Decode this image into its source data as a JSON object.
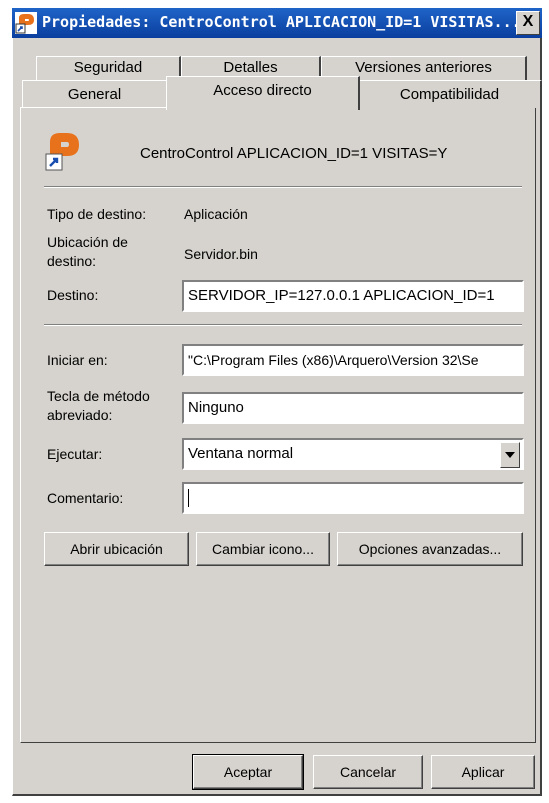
{
  "window": {
    "title": "Propiedades: CentroControl APLICACION_ID=1 VISITAS...",
    "close_label": "X"
  },
  "tabs": {
    "row1": [
      "Seguridad",
      "Detalles",
      "Versiones anteriores"
    ],
    "row2": [
      "General",
      "Acceso directo",
      "Compatibilidad"
    ],
    "active": "Acceso directo"
  },
  "shortcut": {
    "name": "CentroControl APLICACION_ID=1 VISITAS=Y",
    "icon": "shortcut-app-icon"
  },
  "fields": {
    "tipo_label": "Tipo de destino:",
    "tipo_value": "Aplicación",
    "ubicacion_label_1": "Ubicación de",
    "ubicacion_label_2": "destino:",
    "ubicacion_value": "Servidor.bin",
    "destino_label": "Destino:",
    "destino_value": "SERVIDOR_IP=127.0.0.1 APLICACION_ID=1",
    "iniciar_label": "Iniciar en:",
    "iniciar_value": "\"C:\\Program Files (x86)\\Arquero\\Version 32\\Se",
    "tecla_label_1": "Tecla de método",
    "tecla_label_2": "abreviado:",
    "tecla_value": "Ninguno",
    "ejecutar_label": "Ejecutar:",
    "ejecutar_value": "Ventana normal",
    "comentario_label": "Comentario:",
    "comentario_value": ""
  },
  "buttons": {
    "abrir": "Abrir ubicación",
    "cambiar": "Cambiar icono...",
    "opciones": "Opciones avanzadas...",
    "aceptar": "Aceptar",
    "cancelar": "Cancelar",
    "aplicar": "Aplicar"
  },
  "colors": {
    "titlebar": "#0a3e9e",
    "face": "#d6d3ce",
    "icon_orange": "#e8711c"
  }
}
